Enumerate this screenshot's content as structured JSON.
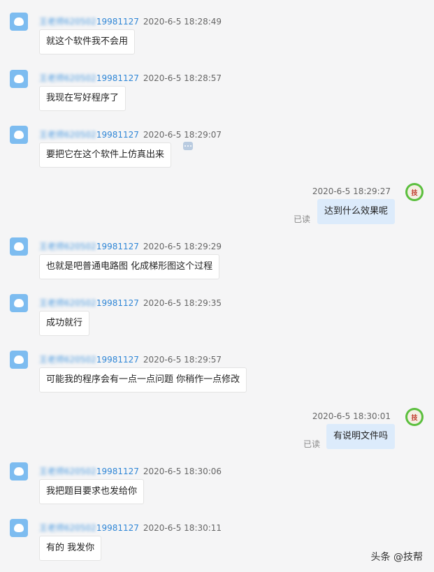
{
  "messages": [
    {
      "id": "m1",
      "side": "left",
      "sender_blur": "王老师620502",
      "sender_tail": "19981127",
      "time": "2020-6-5 18:28:49",
      "text": "就这个软件我不会用"
    },
    {
      "id": "m2",
      "side": "left",
      "sender_blur": "王老师620502",
      "sender_tail": "19981127",
      "time": "2020-6-5 18:28:57",
      "text": "我现在写好程序了"
    },
    {
      "id": "m3",
      "side": "left",
      "sender_blur": "王老师620502",
      "sender_tail": "19981127",
      "time": "2020-6-5 18:29:07",
      "text": "要把它在这个软件上仿真出来"
    },
    {
      "id": "m4",
      "side": "right",
      "time": "2020-6-5 18:29:27",
      "text": "达到什么效果呢",
      "read": "已读"
    },
    {
      "id": "m5",
      "side": "left",
      "sender_blur": "王老师620502",
      "sender_tail": "19981127",
      "time": "2020-6-5 18:29:29",
      "text": "也就是吧普通电路图 化成梯形图这个过程"
    },
    {
      "id": "m6",
      "side": "left",
      "sender_blur": "王老师620502",
      "sender_tail": "19981127",
      "time": "2020-6-5 18:29:35",
      "text": "成功就行"
    },
    {
      "id": "m7",
      "side": "left",
      "sender_blur": "王老师620502",
      "sender_tail": "19981127",
      "time": "2020-6-5 18:29:57",
      "text": "可能我的程序会有一点一点问题 你稍作一点修改"
    },
    {
      "id": "m8",
      "side": "right",
      "time": "2020-6-5 18:30:01",
      "text": "有说明文件吗",
      "read": "已读"
    },
    {
      "id": "m9",
      "side": "left",
      "sender_blur": "王老师620502",
      "sender_tail": "19981127",
      "time": "2020-6-5 18:30:06",
      "text": "我把题目要求也发给你"
    },
    {
      "id": "m10",
      "side": "left",
      "sender_blur": "王老师620502",
      "sender_tail": "19981127",
      "time": "2020-6-5 18:30:11",
      "text": "有的 我发你"
    }
  ],
  "watermark": "头条 @技帮",
  "icons": {
    "left_avatar": "blue-blob-avatar-icon",
    "right_avatar": "green-seal-avatar-icon",
    "more": "more-options-icon"
  },
  "colors": {
    "left_avatar": "#7dbcf0",
    "right_avatar": "#5bbf3e",
    "sender": "#2f86d6",
    "bubble_right": "#dcebfb"
  }
}
